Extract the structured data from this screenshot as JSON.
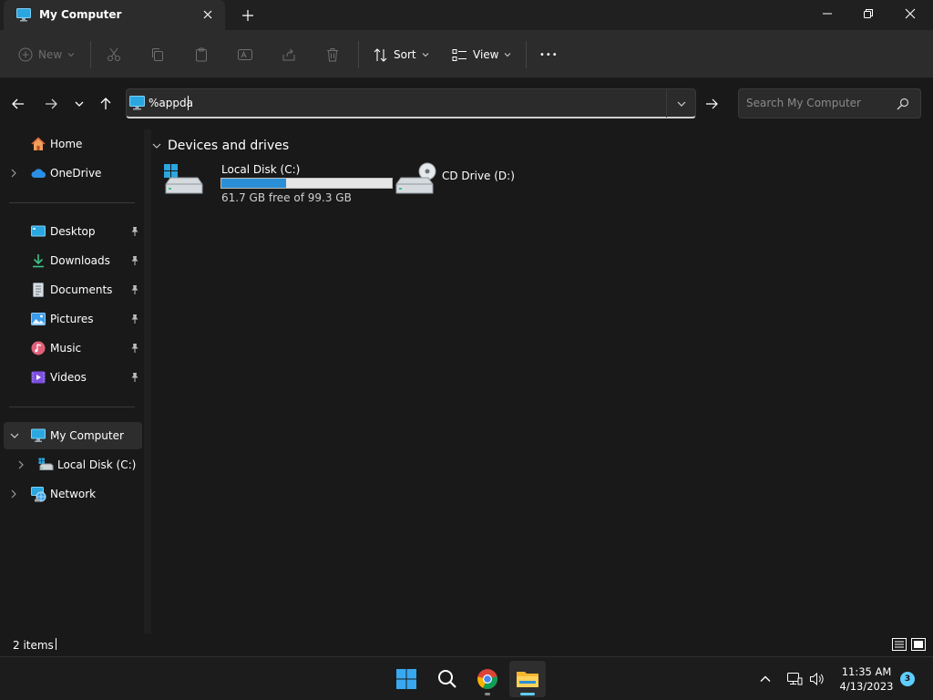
{
  "window": {
    "tab_title": "My Computer",
    "new_tab": "+"
  },
  "commandbar": {
    "new_label": "New",
    "sort_label": "Sort",
    "view_label": "View",
    "more_label": "•••"
  },
  "address": {
    "value": "%appda"
  },
  "search": {
    "placeholder": "Search My Computer"
  },
  "sidebar": {
    "items": [
      {
        "label": "Home",
        "icon": "home-icon"
      },
      {
        "label": "OneDrive",
        "icon": "onedrive-icon"
      },
      {
        "label": "Desktop",
        "icon": "desktop-icon",
        "pinned": true
      },
      {
        "label": "Downloads",
        "icon": "downloads-icon",
        "pinned": true
      },
      {
        "label": "Documents",
        "icon": "documents-icon",
        "pinned": true
      },
      {
        "label": "Pictures",
        "icon": "pictures-icon",
        "pinned": true
      },
      {
        "label": "Music",
        "icon": "music-icon",
        "pinned": true
      },
      {
        "label": "Videos",
        "icon": "videos-icon",
        "pinned": true
      },
      {
        "label": "My Computer",
        "icon": "computer-icon",
        "selected": true
      },
      {
        "label": "Local Disk (C:)",
        "icon": "disk-icon"
      },
      {
        "label": "Network",
        "icon": "network-icon"
      }
    ]
  },
  "content": {
    "group_title": "Devices and drives",
    "drives": [
      {
        "name": "Local Disk (C:)",
        "free_text": "61.7 GB free of 99.3 GB",
        "used_fraction": 0.38
      },
      {
        "name": "CD Drive (D:)"
      }
    ]
  },
  "status": {
    "item_count": "2 items"
  },
  "taskbar": {
    "time": "11:35 AM",
    "date": "4/13/2023",
    "notification_count": "3"
  },
  "colors": {
    "accent": "#60cdff",
    "drive_bar_fill": "#2a8fd6"
  }
}
